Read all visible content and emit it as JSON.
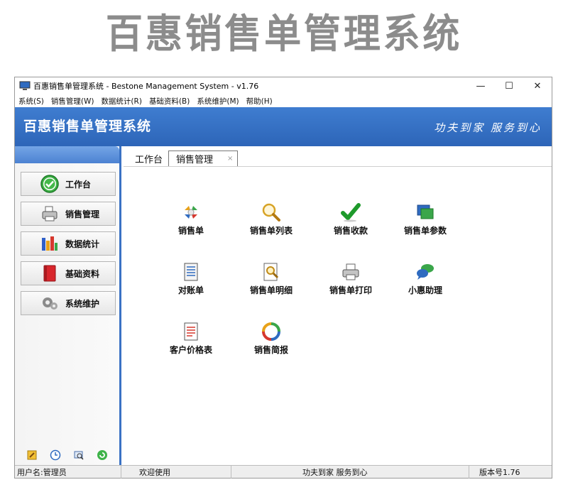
{
  "banner": {
    "title": "百惠销售单管理系统"
  },
  "window": {
    "title": "百惠销售单管理系统 - Bestone Management System - v1.76",
    "controls": {
      "minimize": "—",
      "maximize": "☐",
      "close": "✕"
    }
  },
  "menu": {
    "items": [
      "系统(S)",
      "销售管理(W)",
      "数据统计(R)",
      "基础资料(B)",
      "系统维护(M)",
      "帮助(H)"
    ]
  },
  "header": {
    "title": "百惠销售单管理系统",
    "slogan": "功夫到家 服务到心",
    "color": "#2f6bc0"
  },
  "sidebar": {
    "items": [
      {
        "label": "工作台",
        "icon": "check-circle-icon"
      },
      {
        "label": "销售管理",
        "icon": "printer-icon"
      },
      {
        "label": "数据统计",
        "icon": "bar-chart-icon"
      },
      {
        "label": "基础资料",
        "icon": "book-icon"
      },
      {
        "label": "系统维护",
        "icon": "gear-icon"
      }
    ],
    "bottom_icons": [
      "edit-icon",
      "clock-icon",
      "search-icon",
      "refresh-icon"
    ]
  },
  "tabs": [
    {
      "label": "工作台",
      "active": false
    },
    {
      "label": "销售管理",
      "active": true,
      "close": "×"
    }
  ],
  "tiles": [
    {
      "label": "销售单",
      "icon": "arrows-cycle-icon"
    },
    {
      "label": "销售单列表",
      "icon": "magnifier-icon"
    },
    {
      "label": "销售收款",
      "icon": "checkmark-icon"
    },
    {
      "label": "销售单参数",
      "icon": "windows-stack-icon"
    },
    {
      "label": "对账单",
      "icon": "ledger-icon"
    },
    {
      "label": "销售单明细",
      "icon": "document-search-icon"
    },
    {
      "label": "销售单打印",
      "icon": "printer-icon"
    },
    {
      "label": "小惠助理",
      "icon": "chat-bubbles-icon"
    },
    {
      "label": "客户价格表",
      "icon": "price-list-icon"
    },
    {
      "label": "销售简报",
      "icon": "recycle-icon"
    }
  ],
  "status": {
    "user": "用户名:管理员",
    "welcome": "欢迎使用",
    "slogan": "功夫到家 服务到心",
    "version": "版本号1.76"
  }
}
